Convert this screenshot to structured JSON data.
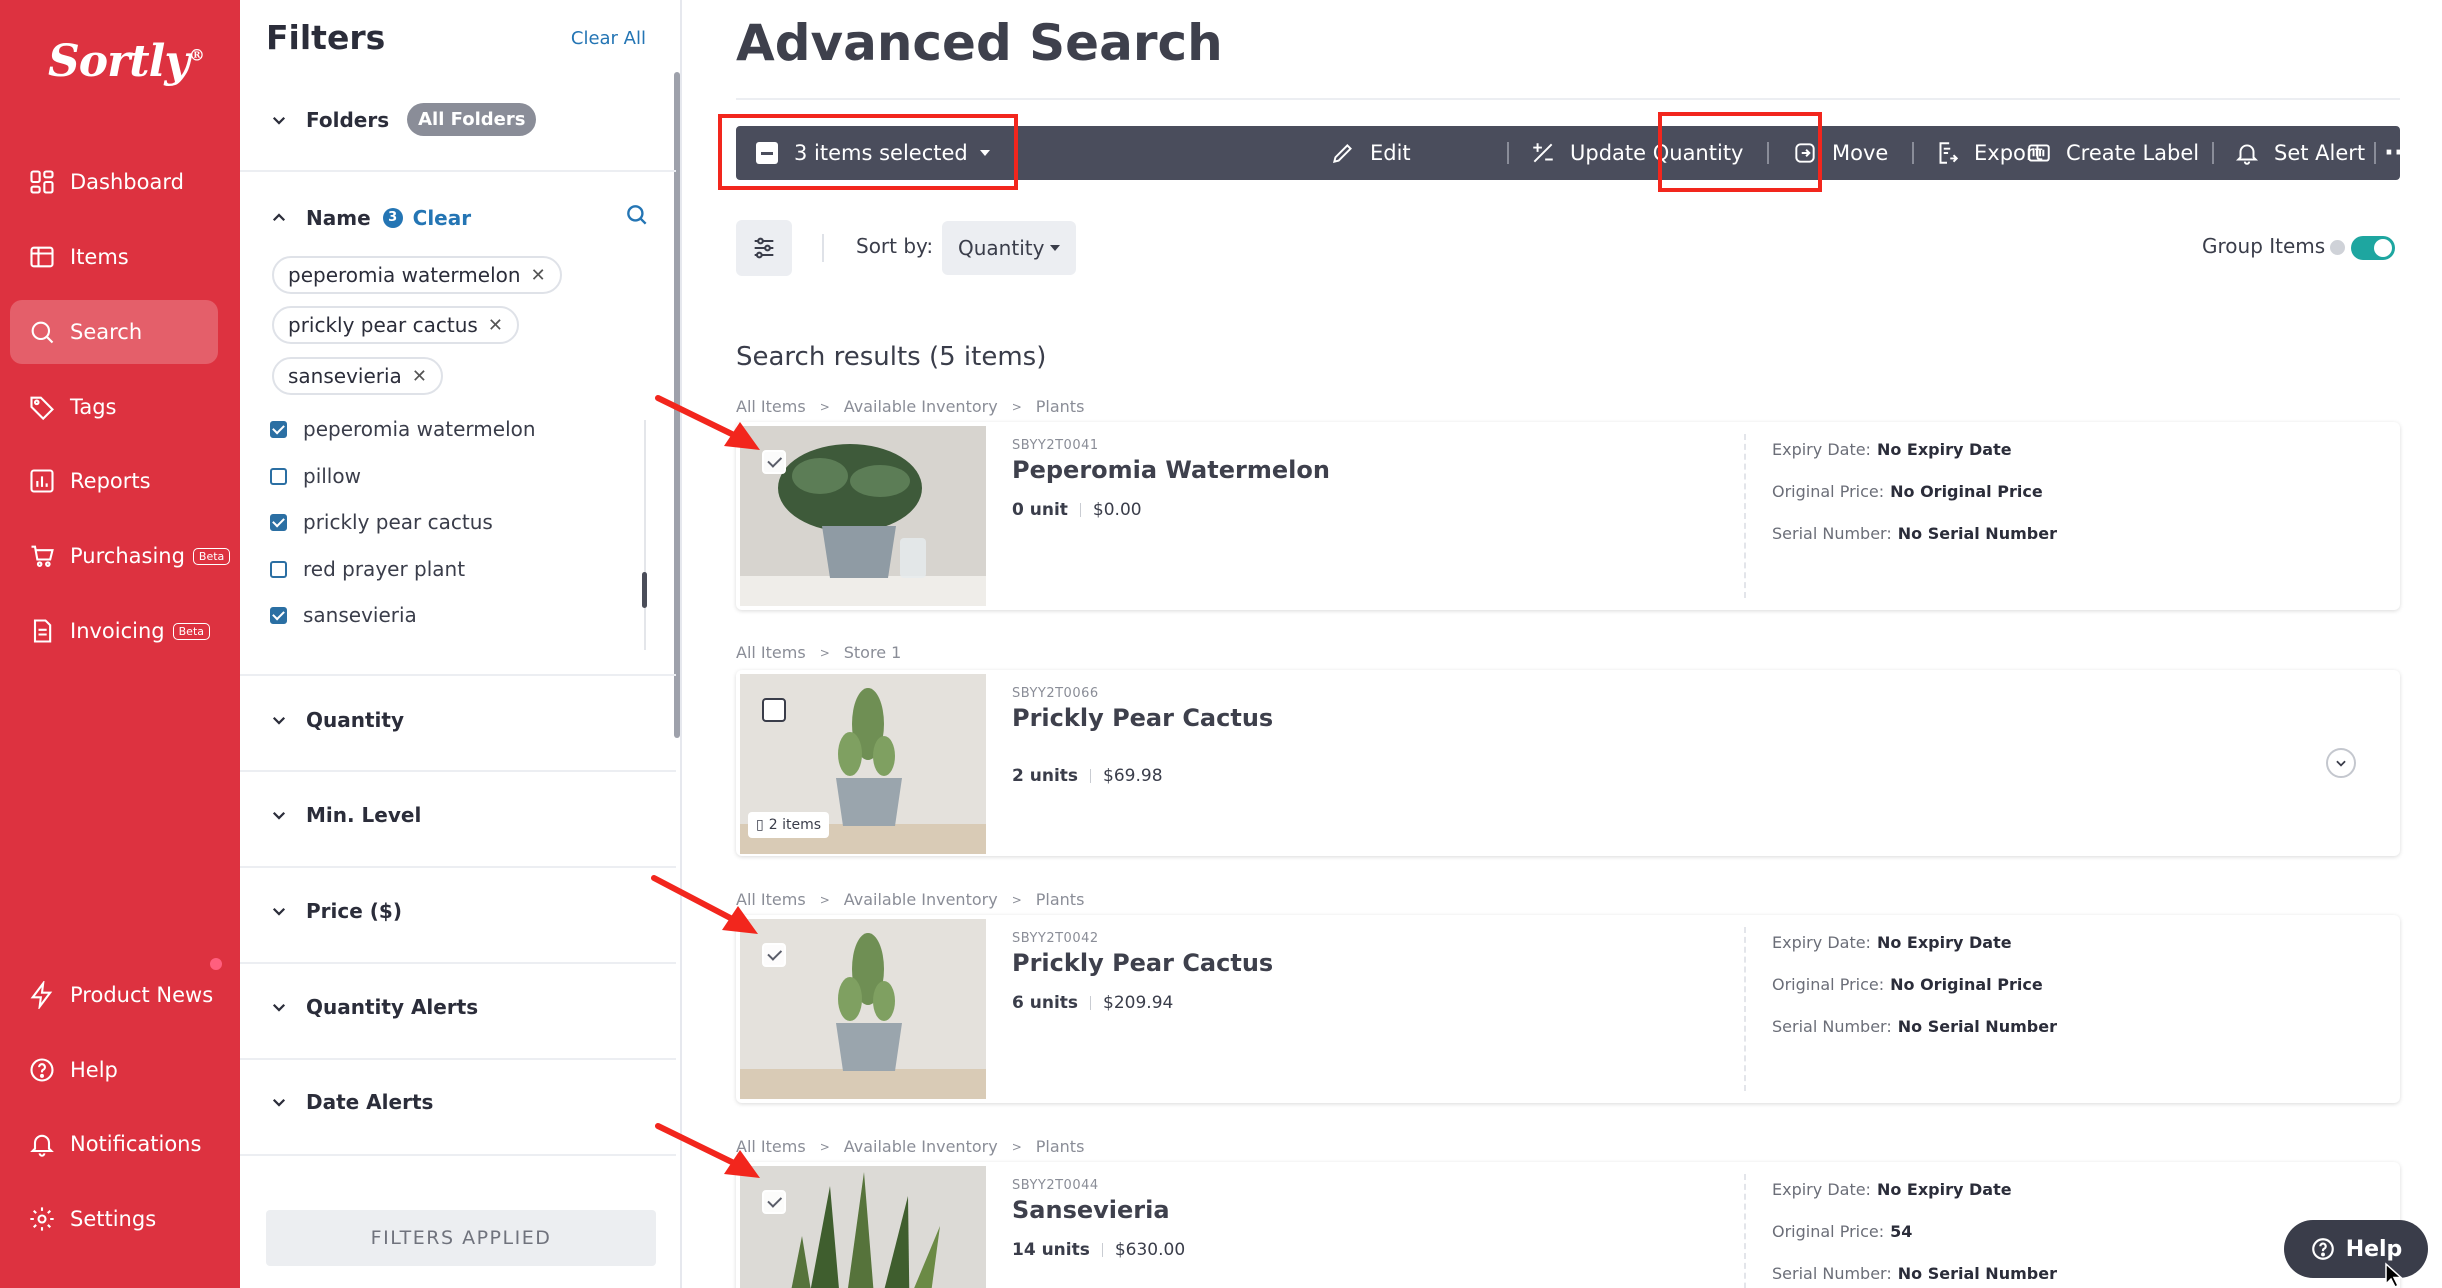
{
  "nav": {
    "logo": "Sortly",
    "logo_mark": "®",
    "items": [
      {
        "label": "Dashboard",
        "icon": "dashboard-icon"
      },
      {
        "label": "Items",
        "icon": "items-icon"
      },
      {
        "label": "Search",
        "icon": "search-icon",
        "active": true
      },
      {
        "label": "Tags",
        "icon": "tag-icon"
      },
      {
        "label": "Reports",
        "icon": "reports-icon"
      },
      {
        "label": "Purchasing",
        "icon": "cart-icon",
        "badge": "Beta"
      },
      {
        "label": "Invoicing",
        "icon": "invoice-icon",
        "badge": "Beta"
      }
    ],
    "bottom": [
      {
        "label": "Product News",
        "icon": "lightning-icon"
      },
      {
        "label": "Help",
        "icon": "help-icon"
      },
      {
        "label": "Notifications",
        "icon": "bell-icon"
      },
      {
        "label": "Settings",
        "icon": "gear-icon"
      }
    ]
  },
  "filters": {
    "title": "Filters",
    "clear_all": "Clear All",
    "folders": {
      "label": "Folders",
      "value": "All Folders"
    },
    "name": {
      "label": "Name",
      "count": "3",
      "clear": "Clear",
      "chips": [
        "peperomia watermelon",
        "prickly pear cactus",
        "sansevieria"
      ],
      "options": [
        {
          "label": "peperomia watermelon",
          "checked": true
        },
        {
          "label": "pillow",
          "checked": false
        },
        {
          "label": "prickly pear cactus",
          "checked": true
        },
        {
          "label": "red prayer plant",
          "checked": false
        },
        {
          "label": "sansevieria",
          "checked": true
        }
      ]
    },
    "sections": [
      "Quantity",
      "Min. Level",
      "Price ($)",
      "Quantity Alerts",
      "Date Alerts"
    ],
    "applied_button": "FILTERS APPLIED"
  },
  "main": {
    "title": "Advanced Search",
    "action_bar": {
      "selected": "3 items selected",
      "edit": "Edit",
      "update_quantity": "Update Quantity",
      "move": "Move",
      "export": "Export",
      "create_label": "Create Label",
      "set_alert": "Set Alert",
      "more": "···"
    },
    "sort_label": "Sort by:",
    "sort_value": "Quantity",
    "group_items": "Group Items",
    "results_title": "Search results (5 items)",
    "results": [
      {
        "crumbs": [
          "All Items",
          "Available Inventory",
          "Plants"
        ],
        "sku": "SBYY2T0041",
        "name": "Peperomia Watermelon",
        "qty": "0 unit",
        "price": "$0.00",
        "checked": true,
        "expiry_label": "Expiry Date:",
        "expiry": "No Expiry Date",
        "orig_label": "Original Price:",
        "orig": "No Original Price",
        "serial_label": "Serial Number:",
        "serial": "No Serial Number"
      },
      {
        "crumbs": [
          "All Items",
          "Store 1"
        ],
        "sku": "SBYY2T0066",
        "name": "Prickly Pear Cactus",
        "qty": "2 units",
        "price": "$69.98",
        "checked": false,
        "group_count": "2 items"
      },
      {
        "crumbs": [
          "All Items",
          "Available Inventory",
          "Plants"
        ],
        "sku": "SBYY2T0042",
        "name": "Prickly Pear Cactus",
        "qty": "6 units",
        "price": "$209.94",
        "checked": true,
        "expiry_label": "Expiry Date:",
        "expiry": "No Expiry Date",
        "orig_label": "Original Price:",
        "orig": "No Original Price",
        "serial_label": "Serial Number:",
        "serial": "No Serial Number"
      },
      {
        "crumbs": [
          "All Items",
          "Available Inventory",
          "Plants"
        ],
        "sku": "SBYY2T0044",
        "name": "Sansevieria",
        "qty": "14 units",
        "price": "$630.00",
        "checked": true,
        "expiry_label": "Expiry Date:",
        "expiry": "No Expiry Date",
        "orig_label": "Original Price:",
        "orig": "54",
        "serial_label": "Serial Number:",
        "serial": "No Serial Number"
      }
    ]
  },
  "help_button": "Help",
  "colors": {
    "brand_red": "#dd3240",
    "action_bar": "#4a4d5c",
    "link_blue": "#2475b4",
    "toggle_teal": "#1ea6a0",
    "annotation_red": "#f2261d"
  }
}
